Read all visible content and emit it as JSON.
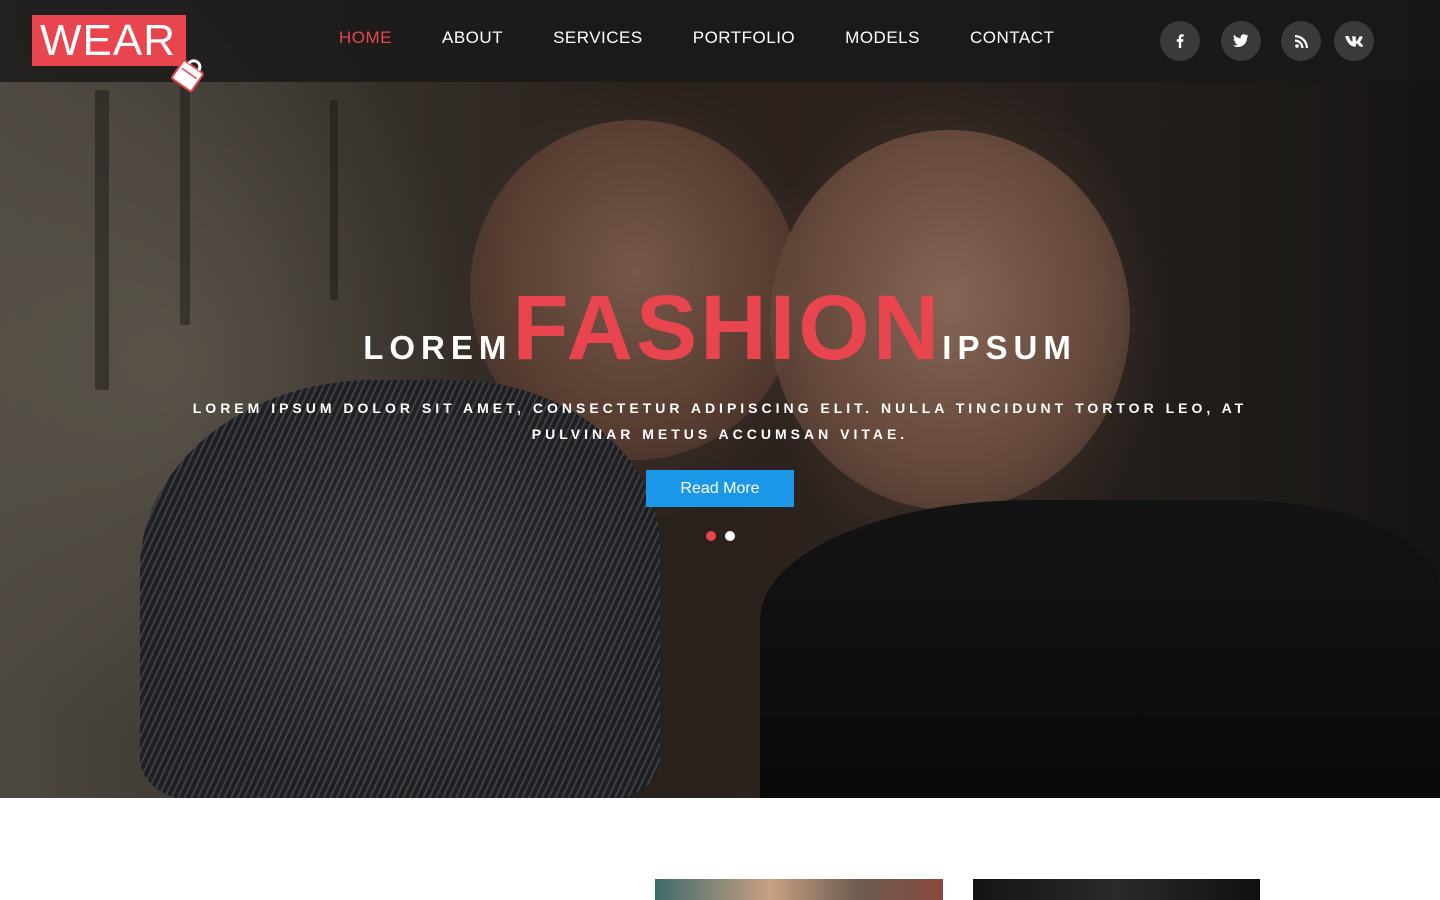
{
  "logo": {
    "text": "WEAR"
  },
  "nav": {
    "items": [
      {
        "label": "HOME",
        "active": true
      },
      {
        "label": "ABOUT"
      },
      {
        "label": "SERVICES"
      },
      {
        "label": "PORTFOLIO"
      },
      {
        "label": "MODELS"
      },
      {
        "label": "CONTACT"
      }
    ]
  },
  "social": [
    {
      "name": "facebook-icon",
      "glyph": "f"
    },
    {
      "name": "twitter-icon"
    },
    {
      "name": "rss-icon"
    },
    {
      "name": "vk-icon",
      "glyph": "vk"
    }
  ],
  "hero": {
    "word_left": "LOREM",
    "word_center": "FASHION",
    "word_right": "IPSUM",
    "subtitle": "LOREM IPSUM DOLOR SIT AMET, CONSECTETUR ADIPISCING ELIT. NULLA TINCIDUNT TORTOR LEO, AT PULVINAR METUS ACCUMSAN VITAE.",
    "button_label": "Read More",
    "slides": 2,
    "active_slide": 1
  },
  "colors": {
    "accent": "#e8454f",
    "button": "#1a97e6",
    "header_bg": "#191919"
  }
}
